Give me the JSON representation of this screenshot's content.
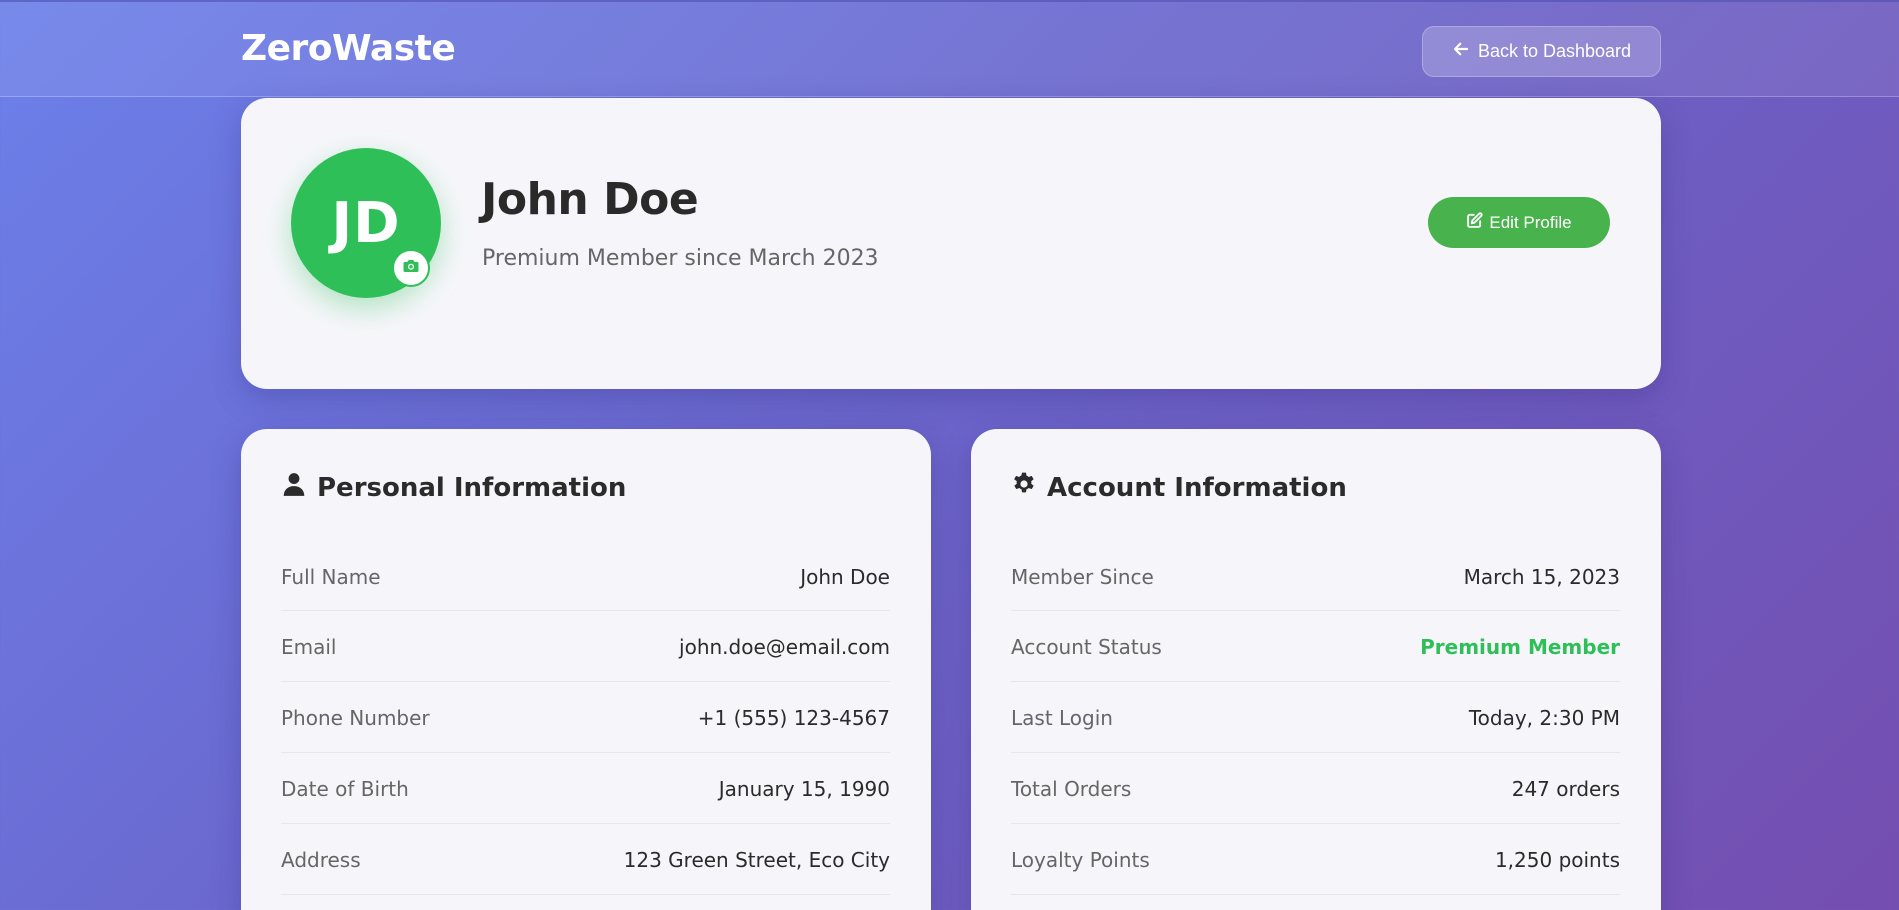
{
  "header": {
    "logo": "ZeroWaste",
    "back_label": "Back to Dashboard"
  },
  "profile": {
    "initials": "JD",
    "name": "John Doe",
    "subtitle": "Premium Member since March 2023",
    "edit_label": "Edit Profile"
  },
  "personal": {
    "title": "Personal Information",
    "rows": [
      {
        "label": "Full Name",
        "value": "John Doe"
      },
      {
        "label": "Email",
        "value": "john.doe@email.com"
      },
      {
        "label": "Phone Number",
        "value": "+1 (555) 123-4567"
      },
      {
        "label": "Date of Birth",
        "value": "January 15, 1990"
      },
      {
        "label": "Address",
        "value": "123 Green Street, Eco City"
      }
    ]
  },
  "account": {
    "title": "Account Information",
    "rows": [
      {
        "label": "Member Since",
        "value": "March 15, 2023"
      },
      {
        "label": "Account Status",
        "value": "Premium Member"
      },
      {
        "label": "Last Login",
        "value": "Today, 2:30 PM"
      },
      {
        "label": "Total Orders",
        "value": "247 orders"
      },
      {
        "label": "Loyalty Points",
        "value": "1,250 points"
      }
    ]
  },
  "colors": {
    "accent_green": "#2fbf58",
    "button_green": "#48b24c",
    "background_start": "#6c80ea",
    "background_end": "#744eb0"
  },
  "icons": {
    "back": "arrow-left-icon",
    "camera": "camera-icon",
    "edit": "edit-icon",
    "personal": "user-icon",
    "account": "gear-icon"
  }
}
